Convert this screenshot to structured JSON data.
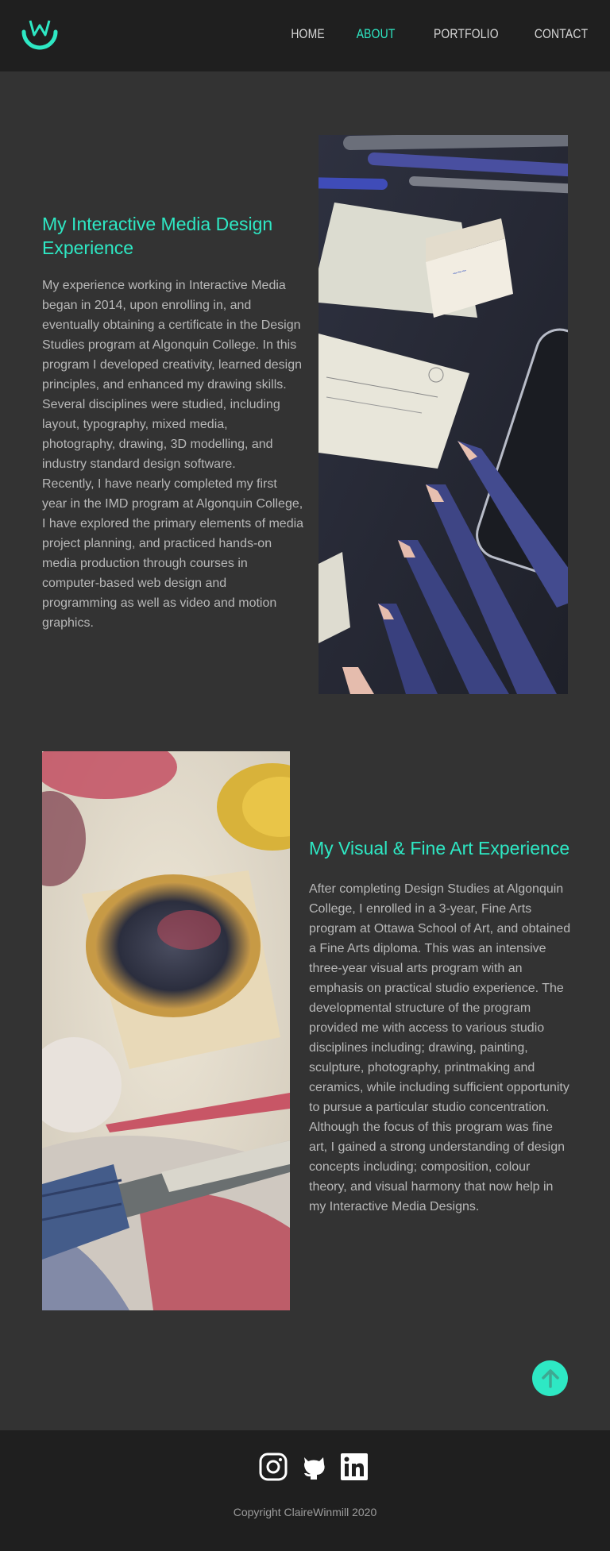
{
  "nav": {
    "items": [
      {
        "label": "HOME",
        "active": false
      },
      {
        "label": "ABOUT",
        "active": true
      },
      {
        "label": "PORTFOLIO",
        "active": false
      },
      {
        "label": "CONTACT",
        "active": false
      }
    ]
  },
  "colors": {
    "accent": "#2ee8c4",
    "background": "#333333",
    "header_bg": "#1f1f1f"
  },
  "section1": {
    "heading": "My Interactive Media Design Experience",
    "paragraph1": "My experience working in Interactive Media began in 2014, upon enrolling in, and eventually obtaining a certificate in the Design Studies program at Algonquin College. In this program I developed creativity, learned design principles, and enhanced my drawing skills. Several disciplines were studied, including layout, typography, mixed media, photography, drawing, 3D modelling, and industry standard design software.",
    "paragraph2": "Recently, I have nearly completed my first year in the IMD program at Algonquin College,  I have explored the primary elements of media project planning, and practiced hands-on media production through courses in computer-based web design and programming as well as video and motion graphics.",
    "image": "pencils-and-sketches-photo"
  },
  "section2": {
    "heading": "My Visual & Fine Art Experience",
    "paragraph": "After completing Design Studies at Algonquin College, I enrolled in a 3-year, Fine Arts program at Ottawa School of Art, and obtained a Fine Arts diploma. This  was an intensive three-year visual arts program with an emphasis on practical studio experience. The developmental structure of the program provided me with access to various studio disciplines including; drawing, painting, sculpture, photography, printmaking and ceramics, while including sufficient opportunity to pursue a particular studio concentration. Although the focus of this program was fine art, I gained a strong understanding of design concepts including; composition, colour theory,  and visual harmony that now help in my Interactive Media Designs.",
    "image": "paint-palette-and-brush-photo"
  },
  "back_to_top": {
    "icon": "arrow-up-icon"
  },
  "footer": {
    "social_icons": [
      "instagram-icon",
      "github-icon",
      "linkedin-icon"
    ],
    "copyright": "Copyright ClaireWinmill 2020"
  }
}
